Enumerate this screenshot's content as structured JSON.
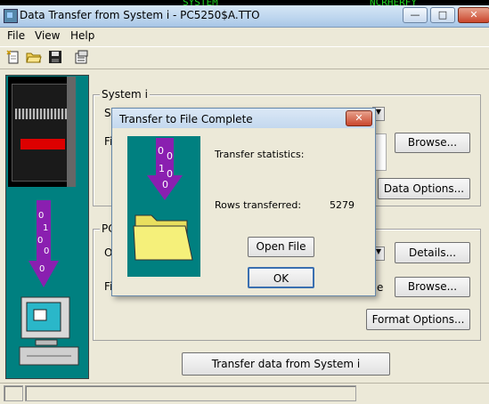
{
  "background_app": {
    "text_a": "SYSTEM",
    "text_b": "NCRHERFY"
  },
  "window": {
    "title": "Data Transfer from System i - PC5250$A.TTO",
    "controls": {
      "minimize": "—",
      "maximize": "□",
      "close": "✕"
    }
  },
  "menu": {
    "file": "File",
    "view": "View",
    "help": "Help"
  },
  "toolbar": {
    "icons": [
      "new-file-icon",
      "open-folder-icon",
      "save-disk-icon",
      "properties-icon"
    ]
  },
  "system_i_group": {
    "label": "System i",
    "system_label_partial": "S",
    "file_label_partial": "Fi",
    "browse_button": "Browse...",
    "data_options_button": "Data Options..."
  },
  "pc_group": {
    "label_partial": "PC",
    "output_label_partial": "O",
    "file_label_partial": "Fi",
    "field_tail": "e",
    "details_button": "Details...",
    "browse_button": "Browse...",
    "format_options_button": "Format Options..."
  },
  "transfer_button": "Transfer data from System i",
  "dialog": {
    "title": "Transfer to File Complete",
    "close": "✕",
    "statistics_label": "Transfer statistics:",
    "rows_label": "Rows transferred:",
    "rows_value": "5279",
    "open_file_button": "Open File",
    "ok_button": "OK"
  },
  "colors": {
    "teal": "#008080",
    "arrow_purple": "#8a1fb0",
    "folder_yellow": "#f5f07a"
  }
}
